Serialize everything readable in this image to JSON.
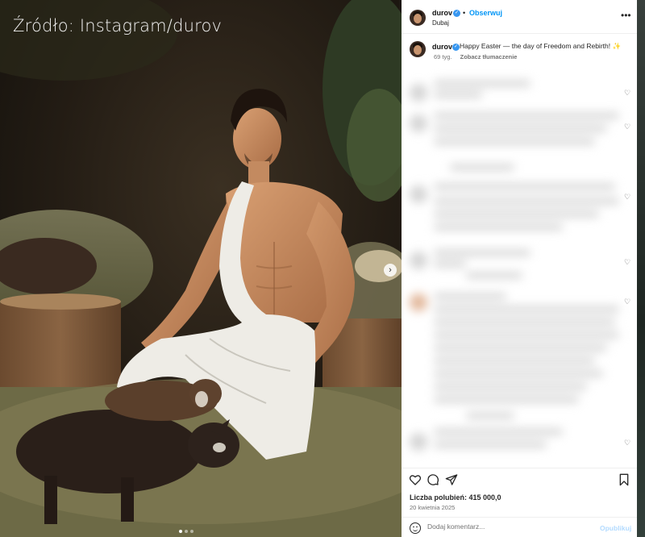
{
  "photo": {
    "watermark": "Źródło: Instagram/durov",
    "carousel_next_icon": "chevron-right-icon",
    "carousel_dots": 3,
    "active_dot": 1
  },
  "header": {
    "username": "durov",
    "separator": "•",
    "follow_label": "Obserwuj",
    "location": "Dubaj",
    "more_icon": "more-horizontal-icon"
  },
  "caption": {
    "username": "durov",
    "text": "Happy Easter — the day of Freedom and Rebirth!",
    "emoji": "✨",
    "age": "69 tyg.",
    "translate_label": "Zobacz tłumaczenie"
  },
  "actions": {
    "likes": "Liczba polubień: 415 000,0",
    "date": "20 kwietnia 2025",
    "icons": [
      "heart-icon",
      "comment-icon",
      "share-icon",
      "bookmark-icon"
    ]
  },
  "comment_bar": {
    "placeholder": "Dodaj komentarz...",
    "post_label": "Opublikuj"
  },
  "colors": {
    "accent": "#0095f6",
    "verified": "#3897f0"
  }
}
